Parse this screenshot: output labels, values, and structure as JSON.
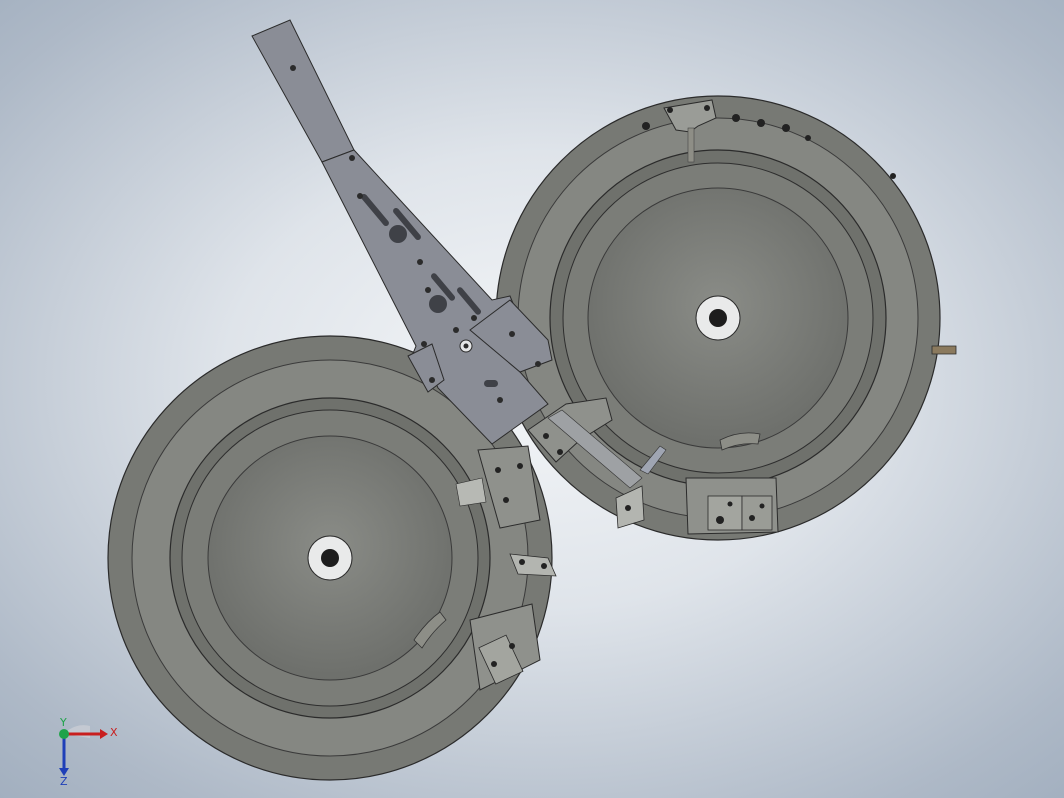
{
  "viewport": {
    "background_colors": [
      "#f4f6f8",
      "#aeb9c7",
      "#97a6b8"
    ]
  },
  "model": {
    "part_color": "#7d7f7a",
    "edge_color": "#2b2b2b",
    "bowls": [
      {
        "name": "left-feeder-bowl"
      },
      {
        "name": "right-feeder-bowl"
      }
    ],
    "mounting_plate": {
      "color": "#8a8d96"
    }
  },
  "triad": {
    "x_label": "X",
    "y_label": "Y",
    "z_label": "Z",
    "x_color": "#c81e1e",
    "y_color": "#1fa34a",
    "z_color": "#1f3fb8"
  }
}
